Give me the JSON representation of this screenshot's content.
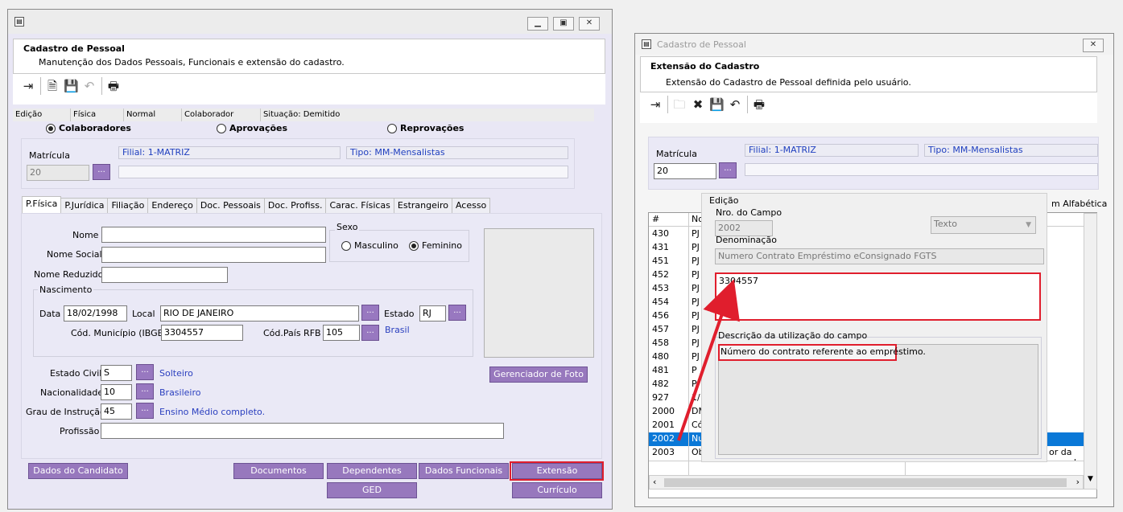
{
  "left": {
    "header": {
      "title": "Cadastro de Pessoal",
      "subtitle": "Manutenção dos Dados Pessoais, Funcionais e extensão do cadastro."
    },
    "status": [
      "Edição",
      "Física",
      "Normal",
      "Colaborador",
      "Situação: Demitido"
    ],
    "radios": [
      {
        "label": "Colaboradores",
        "selected": true
      },
      {
        "label": "Aprovações",
        "selected": false
      },
      {
        "label": "Reprovações",
        "selected": false
      }
    ],
    "matricula": {
      "label": "Matrícula",
      "value": "20",
      "dots": "...",
      "filial": "Filial: 1-MATRIZ",
      "tipo": "Tipo: MM-Mensalistas"
    },
    "tabs": [
      "P.Física",
      "P.Jurídica",
      "Filiação",
      "Endereço",
      "Doc. Pessoais",
      "Doc. Profiss.",
      "Carac. Físicas",
      "Estrangeiro",
      "Acesso"
    ],
    "form": {
      "nome": "Nome",
      "nome_social": "Nome Social",
      "nome_reduzido": "Nome Reduzido",
      "sexo": "Sexo",
      "masculino": "Masculino",
      "feminino": "Feminino",
      "nascimento": "Nascimento",
      "data_label": "Data",
      "data": "18/02/1998",
      "local_label": "Local",
      "local": "RIO DE JANEIRO",
      "estado_label": "Estado",
      "estado": "RJ",
      "cod_mun_label": "Cód. Município (IBGE)",
      "cod_mun": "3304557",
      "cod_pais_label": "Cód.País RFB",
      "cod_pais": "105",
      "pais": "Brasil",
      "estado_civil_label": "Estado Civil",
      "estado_civil": "S",
      "estado_civil_txt": "Solteiro",
      "nacionalidade_label": "Nacionalidade",
      "nacionalidade": "10",
      "nacionalidade_txt": "Brasileiro",
      "grau_label": "Grau de Instrução",
      "grau": "45",
      "grau_txt": "Ensino Médio completo.",
      "profissao_label": "Profissão",
      "foto_btn": "Gerenciador de Foto"
    },
    "buttons": {
      "candidato": "Dados do Candidato",
      "documentos": "Documentos",
      "dependentes": "Dependentes",
      "funcionais": "Dados Funcionais",
      "extensao": "Extensão",
      "ged": "GED",
      "curriculo": "Currículo"
    }
  },
  "right": {
    "window_title": "Cadastro de Pessoal",
    "header": {
      "title": "Extensão do Cadastro",
      "subtitle": "Extensão do Cadastro de Pessoal definida pelo usuário."
    },
    "matricula": {
      "label": "Matrícula",
      "value": "20",
      "dots": "...",
      "filial": "Filial: 1-MATRIZ",
      "tipo": "Tipo: MM-Mensalistas"
    },
    "grid_header": [
      "#",
      "No"
    ],
    "grid_right_header": "m Alfabética",
    "rows": [
      {
        "n": "430",
        "c": "PJ"
      },
      {
        "n": "431",
        "c": "PJ"
      },
      {
        "n": "451",
        "c": "PJ"
      },
      {
        "n": "452",
        "c": "PJ"
      },
      {
        "n": "453",
        "c": "PJ"
      },
      {
        "n": "454",
        "c": "PJ"
      },
      {
        "n": "456",
        "c": "PJ"
      },
      {
        "n": "457",
        "c": "PJ"
      },
      {
        "n": "458",
        "c": "PJ"
      },
      {
        "n": "480",
        "c": "PJ"
      },
      {
        "n": "481",
        "c": "P"
      },
      {
        "n": "482",
        "c": "P"
      },
      {
        "n": "927",
        "c": "1/"
      },
      {
        "n": "2000",
        "c": "DM"
      },
      {
        "n": "2001",
        "c": "Có"
      },
      {
        "n": "2002",
        "c": "Nu"
      },
      {
        "n": "2003",
        "c": "Ob"
      }
    ],
    "row_2003_tail": "or da parcel",
    "edit": {
      "group": "Edição",
      "nro_label": "Nro. do Campo",
      "nro": "2002",
      "tipo": "Texto",
      "denom_label": "Denominação",
      "denom": "Numero Contrato Empréstimo eConsignado FGTS",
      "value": "3304557",
      "desc_label": "Descrição da utilização do campo",
      "desc": "Número do contrato referente ao empréstimo."
    }
  }
}
